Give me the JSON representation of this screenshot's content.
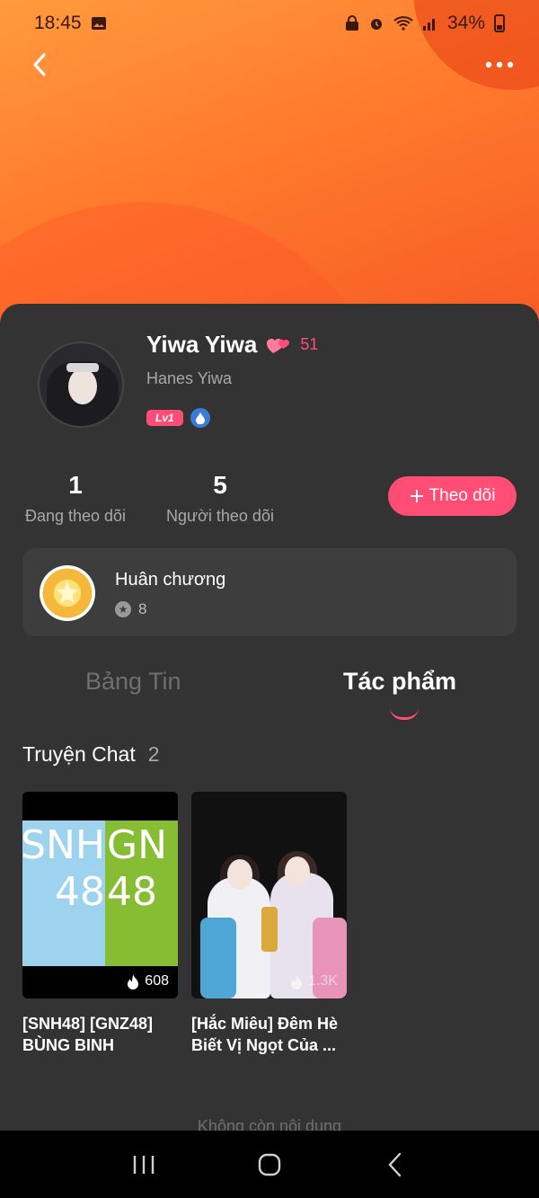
{
  "status_bar": {
    "time": "18:45",
    "battery": "34%",
    "icons": [
      "image-icon",
      "lock-icon",
      "alarm-icon",
      "wifi-icon",
      "signal-icon",
      "battery-icon"
    ]
  },
  "profile": {
    "display_name": "Yiwa Yiwa",
    "hearts_count": "51",
    "username": "Hanes Yiwa",
    "level_badge": "Lv1",
    "following_count": "1",
    "following_label": "Đang theo dõi",
    "followers_count": "5",
    "followers_label": "Người theo dõi",
    "follow_button": "Theo dõi"
  },
  "medals": {
    "title": "Huân chương",
    "count": "8"
  },
  "tabs": [
    {
      "label": "Bảng Tin",
      "active": false
    },
    {
      "label": "Tác phẩm",
      "active": true
    }
  ],
  "section": {
    "title": "Truyện Chat",
    "count": "2"
  },
  "stories": [
    {
      "title": "[SNH48] [GNZ48] BÙNG BINH",
      "views": "608",
      "cover_text_left": "SNH 48",
      "cover_text_right": "GN 48"
    },
    {
      "title": "[Hắc Miêu] Đêm Hè Biết Vị Ngọt Của ...",
      "views": "1.3K"
    }
  ],
  "footer_text": "Không còn nội dung",
  "colors": {
    "accent": "#ff4d75",
    "hero_start": "#ff9a3e",
    "hero_end": "#f65a24",
    "background": "#333333"
  }
}
